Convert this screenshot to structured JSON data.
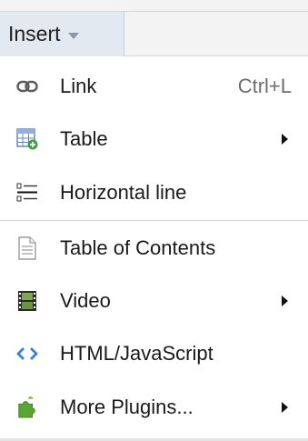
{
  "menubar": {
    "insert_label": "Insert"
  },
  "menu": {
    "items": [
      {
        "label": "Link",
        "shortcut": "Ctrl+L",
        "icon": "link-icon"
      },
      {
        "label": "Table",
        "icon": "table-icon",
        "has_submenu": true
      },
      {
        "label": "Horizontal line",
        "icon": "horizontal-line-icon"
      },
      {
        "label": "Table of Contents",
        "icon": "document-icon"
      },
      {
        "label": "Video",
        "icon": "film-icon",
        "has_submenu": true
      },
      {
        "label": "HTML/JavaScript",
        "icon": "code-icon"
      },
      {
        "label": "More Plugins...",
        "icon": "puzzle-icon",
        "has_submenu": true
      }
    ]
  },
  "colors": {
    "menubar_bg": "#f3f3f3",
    "insert_button_bg": "#e3e9f1",
    "caret": "#8b97a8",
    "separator": "#d6d6d6",
    "code_icon": "#3a7fd5",
    "puzzle_icon": "#5aa632"
  }
}
